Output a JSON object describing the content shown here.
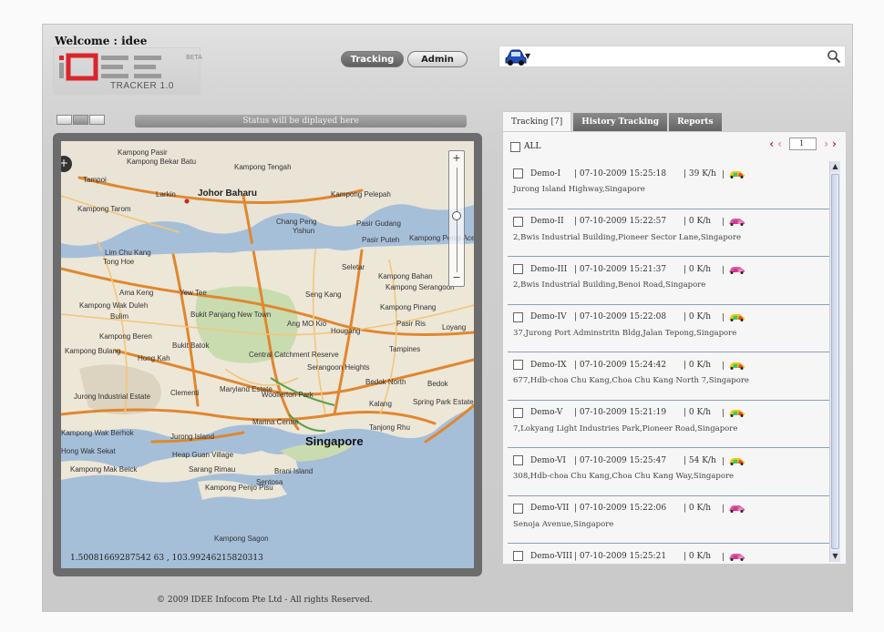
{
  "header": {
    "welcome": "Welcome : idee",
    "logo_text": "iDEE",
    "logo_beta": "BETA",
    "logo_sub": "TRACKER 1.0"
  },
  "nav": {
    "tracking_label": "Tracking",
    "admin_label": "Admin"
  },
  "status": {
    "text": "Status will be diplayed here"
  },
  "map": {
    "coords": "1.50081669287542 63 , 103.99246215820313",
    "labels": [
      "Kampong Pasir",
      "Kampong Bekar Batu",
      "Kampong Tengah",
      "Tampoi",
      "Larkin",
      "Johor Baharu",
      "Kampong Pelepah",
      "Kampong Tarom",
      "Chang Peng",
      "Yishun",
      "Pasir Gudang",
      "Pasir Puteh",
      "Kampong Pengi Aceh",
      "Lim Chu Kang",
      "Tong Hoe",
      "Seletar",
      "Kampong Bahan",
      "Ama Keng",
      "Yew Tee",
      "Seng Kang",
      "Kampong Serangoon",
      "Kampong Wak Duleh",
      "Bulim",
      "Bukit Panjang New Town",
      "Ang MO Kio",
      "Kampong Pinang",
      "Kampong Beren",
      "Bukit Batok",
      "Hougang",
      "Tampines",
      "Pasir Ris",
      "Loyang",
      "Kampong Bulang",
      "Hong Kah",
      "Central Catchment Reserve",
      "Serangoon Heights",
      "Bedok North",
      "Bedok",
      "Jurong Industrial Estate",
      "Clementi",
      "Maryland Estate",
      "Woollerton Park",
      "Kalang",
      "Spring Park Estate",
      "Kampong Wak Berhok",
      "Jurong Island",
      "Marina Centre",
      "Tanjong Rhu",
      "Hong Wak Sekat",
      "Heap Guan Village",
      "Singapore",
      "Kampong Mak Beick",
      "Sarang Rimau",
      "Brani Island",
      "Sentosa",
      "Kampong Penjo Pisu",
      "Kampong Sagon"
    ]
  },
  "tabs": [
    {
      "label": "Tracking [7]"
    },
    {
      "label": "History Tracking"
    },
    {
      "label": "Reports"
    }
  ],
  "list": {
    "all_label": "ALL",
    "page": "1",
    "rows": [
      {
        "name": "Demo-I",
        "time": "| 07-10-2009 15:25:18",
        "speed": "| 39 K/h",
        "status": "moving",
        "address": "Jurong Island Highway,Singapore"
      },
      {
        "name": "Demo-II",
        "time": "| 07-10-2009 15:22:57",
        "speed": "| 0 K/h",
        "status": "stopped",
        "address": "2,Bwis Industrial Building,Pioneer Sector Lane,Singapore"
      },
      {
        "name": "Demo-III",
        "time": "| 07-10-2009 15:21:37",
        "speed": "| 0 K/h",
        "status": "stopped",
        "address": "2,Bwis Industrial Building,Benoi Road,Singapore"
      },
      {
        "name": "Demo-IV",
        "time": "| 07-10-2009 15:22:08",
        "speed": "| 0 K/h",
        "status": "moving",
        "address": "37,Jurong Port Adminstritn Bldg,Jalan Tepong,Singapore"
      },
      {
        "name": "Demo-IX",
        "time": "| 07-10-2009 15:24:42",
        "speed": "| 0 K/h",
        "status": "moving",
        "address": "677,Hdb-choa Chu Kang,Choa Chu Kang North 7,Singapore"
      },
      {
        "name": "Demo-V",
        "time": "| 07-10-2009 15:21:19",
        "speed": "| 0 K/h",
        "status": "moving",
        "address": "7,Lokyang Light Industries Park,Pioneer Road,Singapore"
      },
      {
        "name": "Demo-VI",
        "time": "| 07-10-2009 15:25:47",
        "speed": "| 54 K/h",
        "status": "moving",
        "address": "308,Hdb-choa Chu Kang,Choa Chu Kang Way,Singapore"
      },
      {
        "name": "Demo-VII",
        "time": "| 07-10-2009 15:22:06",
        "speed": "| 0 K/h",
        "status": "stopped",
        "address": "Senoja Avenue,Singapore"
      },
      {
        "name": "Demo-VIII",
        "time": "| 07-10-2009 15:25:21",
        "speed": "| 0 K/h",
        "status": "stopped",
        "address": ""
      }
    ]
  },
  "footer": {
    "text": "© 2009 IDEE Infocom Pte Ltd - All rights Reserved."
  }
}
